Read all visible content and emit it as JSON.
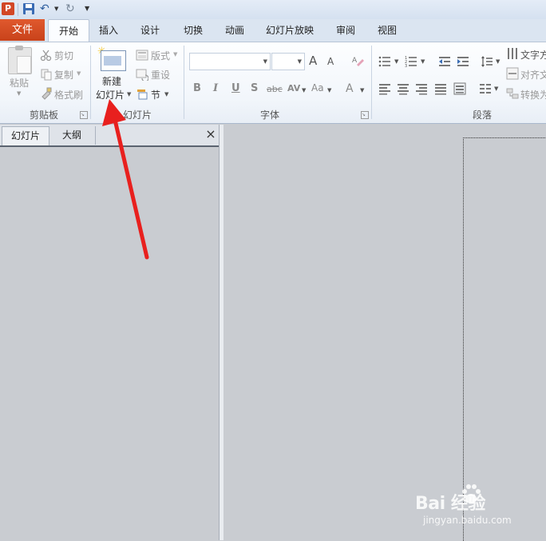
{
  "qat": {
    "app_icon": "P",
    "icons": [
      "powerpoint-app-icon",
      "save-icon",
      "undo-icon",
      "redo-icon",
      "customize-qat-icon"
    ]
  },
  "tabs": {
    "file": "文件",
    "items": [
      "开始",
      "插入",
      "设计",
      "切换",
      "动画",
      "幻灯片放映",
      "审阅",
      "视图"
    ]
  },
  "ribbon": {
    "clipboard": {
      "paste": "粘贴",
      "cut": "剪切",
      "copy": "复制",
      "format_painter": "格式刷",
      "label": "剪贴板"
    },
    "slides": {
      "new_slide_line1": "新建",
      "new_slide_line2": "幻灯片",
      "layout": "版式",
      "reset": "重设",
      "section": "节",
      "label": "幻灯片"
    },
    "font": {
      "font_name": "",
      "font_size": "",
      "grow": "A",
      "shrink": "A",
      "bold": "B",
      "italic": "I",
      "underline": "U",
      "shadow": "S",
      "strike": "abc",
      "spacing": "AV",
      "case": "Aa",
      "color": "A",
      "label": "字体"
    },
    "paragraph": {
      "text_direction": "文字方",
      "align_text": "对齐文",
      "convert_smartart": "转换为",
      "label": "段落"
    }
  },
  "left_pane": {
    "tab_slides": "幻灯片",
    "tab_outline": "大纲",
    "close": "×"
  },
  "watermark": {
    "logo": "Bai 经验",
    "url": "jingyan.baidu.com"
  },
  "colors": {
    "file_tab": "#d24726",
    "annotation_arrow": "#e8201e",
    "workspace": "#c9ccd1"
  }
}
